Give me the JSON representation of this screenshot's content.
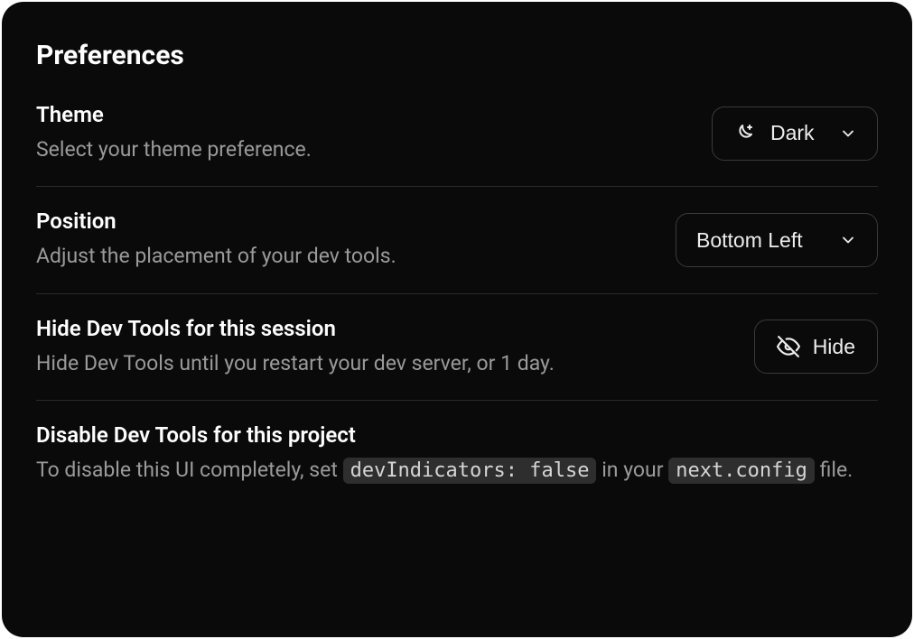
{
  "panel": {
    "title": "Preferences"
  },
  "theme": {
    "title": "Theme",
    "subtitle": "Select your theme preference.",
    "value": "Dark"
  },
  "position": {
    "title": "Position",
    "subtitle": "Adjust the placement of your dev tools.",
    "value": "Bottom Left"
  },
  "hide": {
    "title": "Hide Dev Tools for this session",
    "subtitle": "Hide Dev Tools until you restart your dev server, or 1 day.",
    "button": "Hide"
  },
  "disable": {
    "title": "Disable Dev Tools for this project",
    "sub_pre": "To disable this UI completely, set ",
    "code1": "devIndicators: false",
    "sub_mid": " in your ",
    "code2": "next.config",
    "sub_post": " file."
  }
}
